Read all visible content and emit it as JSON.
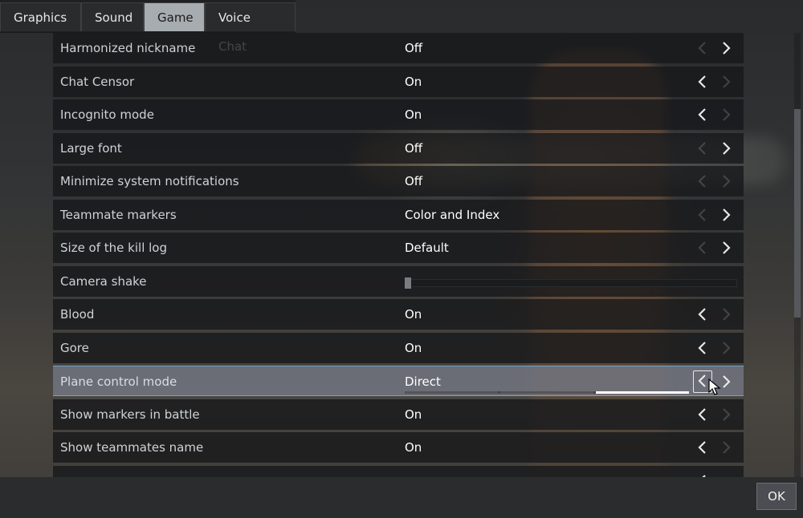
{
  "tabs": [
    {
      "label": "Graphics"
    },
    {
      "label": "Sound"
    },
    {
      "label": "Game",
      "active": true
    },
    {
      "label": "Voice Chat"
    }
  ],
  "settings": [
    {
      "label": "Harmonized nickname",
      "value": "Off"
    },
    {
      "label": "Chat Censor",
      "value": "On"
    },
    {
      "label": "Incognito mode",
      "value": "On"
    },
    {
      "label": "Large font",
      "value": "Off"
    },
    {
      "label": "Minimize system notifications",
      "value": "Off"
    },
    {
      "label": "Teammate markers",
      "value": "Color and Index"
    },
    {
      "label": "Size of the kill log",
      "value": "Default"
    },
    {
      "label": "Camera shake",
      "slider_level": 0.0
    },
    {
      "label": "Blood",
      "value": "On"
    },
    {
      "label": "Gore",
      "value": "On"
    },
    {
      "label": "Plane control mode",
      "value": "Direct",
      "selected": true,
      "mode_index": 3,
      "mode_count": 3
    },
    {
      "label": "Show markers in battle",
      "value": "On"
    },
    {
      "label": "Show teammates name",
      "value": "On"
    }
  ],
  "footer": {
    "ok_label": "OK"
  },
  "icons": {
    "prev": "chevron-left-icon",
    "next": "chevron-right-icon",
    "cursor": "mouse-pointer-icon"
  },
  "colors": {
    "selected_row": "#787d8c",
    "selected_border": "#6fa6c8",
    "active_tab": "#a7acb0"
  }
}
